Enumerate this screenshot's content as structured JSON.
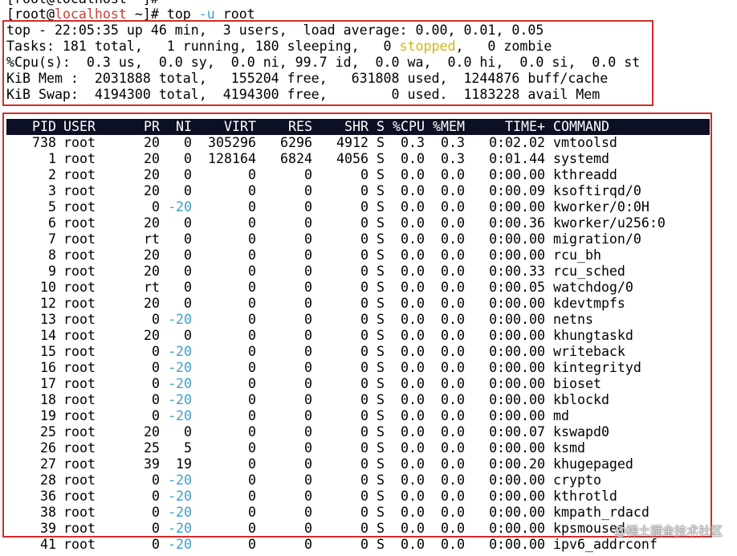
{
  "terminal": {
    "prev_line": "[root@localhost ~]#",
    "prompt": {
      "open": "[root@",
      "host": "localhost",
      "close": " ~]# top ",
      "flag": "-u",
      "arg": " root"
    },
    "summary": {
      "uptime_line": "top - 22:05:35 up 46 min,  3 users,  load average: 0.00, 0.01, 0.05",
      "tasks_pre": "Tasks: 181 total,   1 running, 180 sleeping,   0 ",
      "tasks_stopped": "stopped",
      "tasks_post": ",   0 zombie",
      "cpu_line": "%Cpu(s):  0.3 us,  0.0 sy,  0.0 ni, 99.7 id,  0.0 wa,  0.0 hi,  0.0 si,  0.0 st",
      "mem_line": "KiB Mem :  2031888 total,   155204 free,   631808 used,  1244876 buff/cache",
      "swap_line": "KiB Swap:  4194300 total,  4194300 free,        0 used.  1183228 avail Mem"
    },
    "columns": [
      "PID",
      "USER",
      "PR",
      "NI",
      "VIRT",
      "RES",
      "SHR",
      "S",
      "%CPU",
      "%MEM",
      "TIME+",
      "COMMAND"
    ],
    "processes": [
      [
        "738",
        "root",
        "20",
        "0",
        "305296",
        "6296",
        "4912",
        "S",
        "0.3",
        "0.3",
        "0:02.02",
        "vmtoolsd"
      ],
      [
        "1",
        "root",
        "20",
        "0",
        "128164",
        "6824",
        "4056",
        "S",
        "0.0",
        "0.3",
        "0:01.44",
        "systemd"
      ],
      [
        "2",
        "root",
        "20",
        "0",
        "0",
        "0",
        "0",
        "S",
        "0.0",
        "0.0",
        "0:00.00",
        "kthreadd"
      ],
      [
        "3",
        "root",
        "20",
        "0",
        "0",
        "0",
        "0",
        "S",
        "0.0",
        "0.0",
        "0:00.09",
        "ksoftirqd/0"
      ],
      [
        "5",
        "root",
        "0",
        "-20",
        "0",
        "0",
        "0",
        "S",
        "0.0",
        "0.0",
        "0:00.00",
        "kworker/0:0H"
      ],
      [
        "6",
        "root",
        "20",
        "0",
        "0",
        "0",
        "0",
        "S",
        "0.0",
        "0.0",
        "0:00.36",
        "kworker/u256:0"
      ],
      [
        "7",
        "root",
        "rt",
        "0",
        "0",
        "0",
        "0",
        "S",
        "0.0",
        "0.0",
        "0:00.00",
        "migration/0"
      ],
      [
        "8",
        "root",
        "20",
        "0",
        "0",
        "0",
        "0",
        "S",
        "0.0",
        "0.0",
        "0:00.00",
        "rcu_bh"
      ],
      [
        "9",
        "root",
        "20",
        "0",
        "0",
        "0",
        "0",
        "S",
        "0.0",
        "0.0",
        "0:00.33",
        "rcu_sched"
      ],
      [
        "10",
        "root",
        "rt",
        "0",
        "0",
        "0",
        "0",
        "S",
        "0.0",
        "0.0",
        "0:00.05",
        "watchdog/0"
      ],
      [
        "12",
        "root",
        "20",
        "0",
        "0",
        "0",
        "0",
        "S",
        "0.0",
        "0.0",
        "0:00.00",
        "kdevtmpfs"
      ],
      [
        "13",
        "root",
        "0",
        "-20",
        "0",
        "0",
        "0",
        "S",
        "0.0",
        "0.0",
        "0:00.00",
        "netns"
      ],
      [
        "14",
        "root",
        "20",
        "0",
        "0",
        "0",
        "0",
        "S",
        "0.0",
        "0.0",
        "0:00.00",
        "khungtaskd"
      ],
      [
        "15",
        "root",
        "0",
        "-20",
        "0",
        "0",
        "0",
        "S",
        "0.0",
        "0.0",
        "0:00.00",
        "writeback"
      ],
      [
        "16",
        "root",
        "0",
        "-20",
        "0",
        "0",
        "0",
        "S",
        "0.0",
        "0.0",
        "0:00.00",
        "kintegrityd"
      ],
      [
        "17",
        "root",
        "0",
        "-20",
        "0",
        "0",
        "0",
        "S",
        "0.0",
        "0.0",
        "0:00.00",
        "bioset"
      ],
      [
        "18",
        "root",
        "0",
        "-20",
        "0",
        "0",
        "0",
        "S",
        "0.0",
        "0.0",
        "0:00.00",
        "kblockd"
      ],
      [
        "19",
        "root",
        "0",
        "-20",
        "0",
        "0",
        "0",
        "S",
        "0.0",
        "0.0",
        "0:00.00",
        "md"
      ],
      [
        "25",
        "root",
        "20",
        "0",
        "0",
        "0",
        "0",
        "S",
        "0.0",
        "0.0",
        "0:00.07",
        "kswapd0"
      ],
      [
        "26",
        "root",
        "25",
        "5",
        "0",
        "0",
        "0",
        "S",
        "0.0",
        "0.0",
        "0:00.00",
        "ksmd"
      ],
      [
        "27",
        "root",
        "39",
        "19",
        "0",
        "0",
        "0",
        "S",
        "0.0",
        "0.0",
        "0:00.20",
        "khugepaged"
      ],
      [
        "28",
        "root",
        "0",
        "-20",
        "0",
        "0",
        "0",
        "S",
        "0.0",
        "0.0",
        "0:00.00",
        "crypto"
      ],
      [
        "36",
        "root",
        "0",
        "-20",
        "0",
        "0",
        "0",
        "S",
        "0.0",
        "0.0",
        "0:00.00",
        "kthrotld"
      ],
      [
        "38",
        "root",
        "0",
        "-20",
        "0",
        "0",
        "0",
        "S",
        "0.0",
        "0.0",
        "0:00.00",
        "kmpath_rdacd"
      ],
      [
        "39",
        "root",
        "0",
        "-20",
        "0",
        "0",
        "0",
        "S",
        "0.0",
        "0.0",
        "0:00.00",
        "kpsmoused"
      ],
      [
        "41",
        "root",
        "0",
        "-20",
        "0",
        "0",
        "0",
        "S",
        "0.0",
        "0.0",
        "0:00.00",
        "ipv6_addrconf"
      ]
    ]
  },
  "colors": {
    "header_bar": "#0c1024",
    "highlight_box": "#d62b2b",
    "host_text": "#c2413b",
    "flag_text": "#3aa0c8",
    "negative_nice": "#3aa0c8",
    "stopped_text": "#d8b600"
  },
  "watermark": "@稀土掘金技术社区"
}
